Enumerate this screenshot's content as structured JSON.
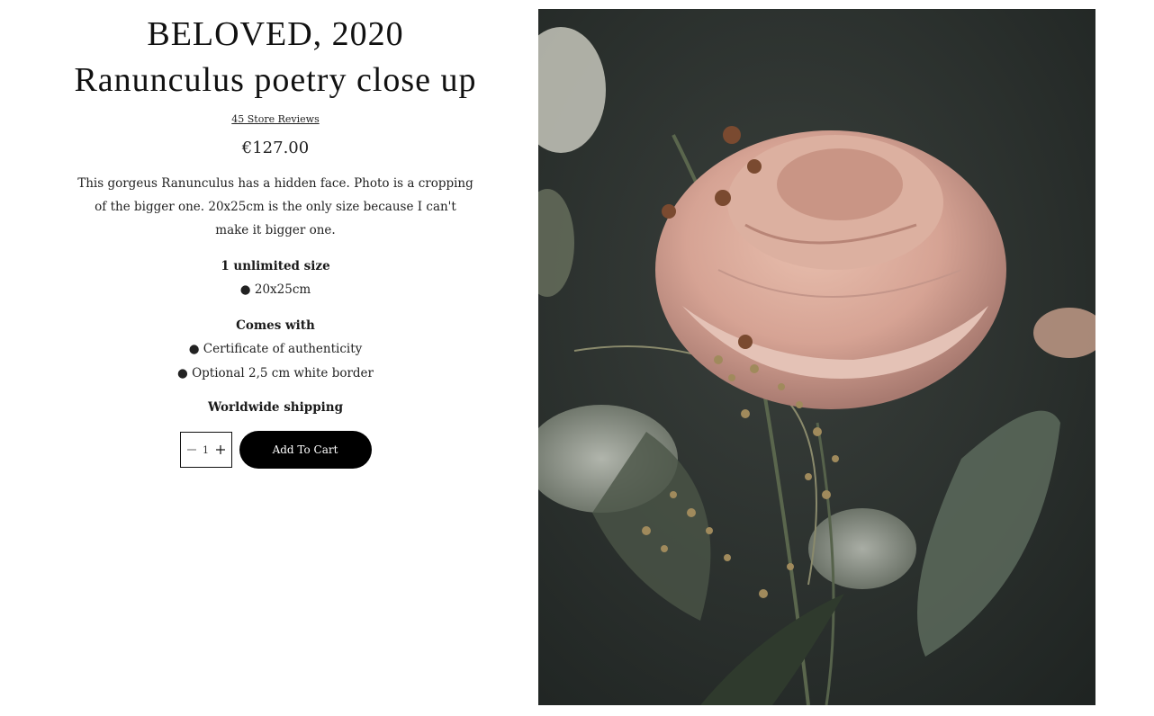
{
  "product": {
    "collection": "BELOVED, 2020",
    "title": "Ranunculus poetry close up",
    "reviews_link": "45 Store Reviews",
    "price": "€127.00",
    "description": "This gorgeus Ranunculus has a hidden face. Photo is a cropping of the bigger one. 20x25cm is the only size because I can't make it bigger one.",
    "size_heading": "1 unlimited size",
    "size_option": "● 20x25cm",
    "includes_heading": "Comes with",
    "includes": [
      "● Certificate of authenticity",
      "● Optional 2,5 cm white border"
    ],
    "shipping": "Worldwide shipping"
  },
  "cart": {
    "quantity": "1",
    "add_label": "Add To Cart",
    "minus_icon": "minus-icon",
    "plus_icon": "plus-icon"
  },
  "image": {
    "subject": "ranunculus-flower-photo",
    "colors": {
      "background": "#2c3230",
      "petal": "#d9a99a",
      "foliage": "#4d5a47"
    }
  }
}
